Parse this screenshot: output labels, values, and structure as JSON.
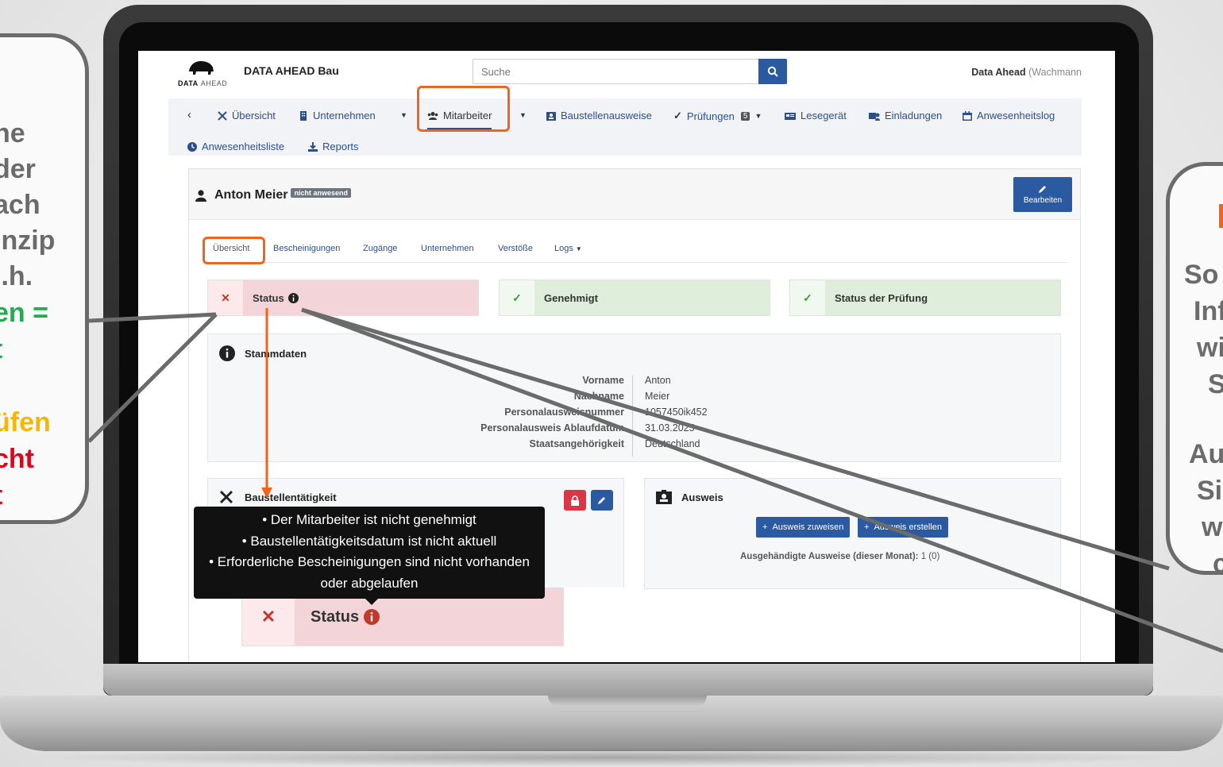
{
  "header": {
    "logo_text": "DATA",
    "logo_text2": "AHEAD",
    "company": "DATA AHEAD Bau",
    "search_placeholder": "Suche",
    "user_name": "Data Ahead",
    "user_role": "(Wachmann"
  },
  "nav": {
    "items": [
      {
        "label": "Übersicht",
        "icon": "tools-icon"
      },
      {
        "label": "Unternehmen",
        "icon": "building-icon"
      },
      {
        "label": "Mitarbeiter",
        "icon": "users-icon"
      },
      {
        "label": "Baustellenausweise",
        "icon": "id-badge-icon"
      },
      {
        "label": "Prüfungen",
        "icon": "check-icon",
        "badge": "5"
      },
      {
        "label": "Lesegerät",
        "icon": "card-reader-icon"
      },
      {
        "label": "Einladungen",
        "icon": "invite-icon"
      },
      {
        "label": "Anwesenheitslog",
        "icon": "calendar-icon"
      },
      {
        "label": "Anwesenheitsliste",
        "icon": "clock-icon"
      },
      {
        "label": "Reports",
        "icon": "download-icon"
      }
    ]
  },
  "employee": {
    "name": "Anton Meier",
    "presence_badge": "nicht anwesend",
    "edit_label": "Bearbeiten"
  },
  "subtabs": [
    "Übersicht",
    "Bescheinigungen",
    "Zugänge",
    "Unternehmen",
    "Verstöße",
    "Logs"
  ],
  "status_cards": [
    {
      "label": "Status",
      "state": "error"
    },
    {
      "label": "Genehmigt",
      "state": "ok"
    },
    {
      "label": "Status der Prüfung",
      "state": "ok"
    }
  ],
  "master_data": {
    "title": "Stammdaten",
    "rows": [
      {
        "key": "Vorname",
        "value": "Anton"
      },
      {
        "key": "Nachname",
        "value": "Meier"
      },
      {
        "key": "Personalausweisnummer",
        "value": "1057450ik452"
      },
      {
        "key": "Personalausweis Ablaufdatum",
        "value": "31.03.2025"
      },
      {
        "key": "Staatsangehörigkeit",
        "value": "Deutschland"
      }
    ]
  },
  "site_activity": {
    "title": "Baustellentätigkeit"
  },
  "badge_panel": {
    "title": "Ausweis",
    "assign_label": "Ausweis zuweisen",
    "create_label": "Ausweis erstellen",
    "handed_label": "Ausgehändigte Ausweise (dieser Monat):",
    "handed_value": "1 (0)"
  },
  "tooltip": {
    "lines": [
      "• Der Mitarbeiter ist nicht genehmigt",
      "• Baustellentätigkeitsdatum ist nicht aktuell",
      "• Erforderliche Bescheinigungen sind nicht vorhanden",
      "oder abgelaufen"
    ]
  },
  "zoomed_status": {
    "label": "Status"
  },
  "left_bubble": {
    "lines": [
      {
        "text": "ne",
        "color": "#6b6b6b"
      },
      {
        "text": "der",
        "color": "#6b6b6b"
      },
      {
        "text": "ach",
        "color": "#6b6b6b"
      },
      {
        "text": "inzip",
        "color": "#6b6b6b"
      },
      {
        "text": "l.h.",
        "color": "#6b6b6b"
      },
      {
        "text": "en =",
        "color": "#1fae4b"
      },
      {
        "text": "t",
        "color": "#1fae4b"
      },
      {
        "text": "üfen",
        "color": "#f5b800"
      },
      {
        "text": "cht",
        "color": "#e3001b"
      },
      {
        "text": "t",
        "color": "#e3001b"
      }
    ]
  },
  "right_bubble": {
    "lines": [
      {
        "text": "So",
        "color": "#6b6b6b"
      },
      {
        "text": "Inf",
        "color": "#6b6b6b"
      },
      {
        "text": "wi",
        "color": "#6b6b6b"
      },
      {
        "text": "S",
        "color": "#6b6b6b"
      },
      {
        "text": "Au",
        "color": "#6b6b6b"
      },
      {
        "text": "Si",
        "color": "#6b6b6b"
      },
      {
        "text": "w",
        "color": "#6b6b6b"
      },
      {
        "text": "c",
        "color": "#6b6b6b"
      }
    ],
    "top_accent_color": "#f0641e"
  },
  "colors": {
    "primary": "#2c5aa0",
    "highlight": "#f0641e",
    "error_bg": "#f3d5d9",
    "ok_bg": "#dfeedb"
  }
}
